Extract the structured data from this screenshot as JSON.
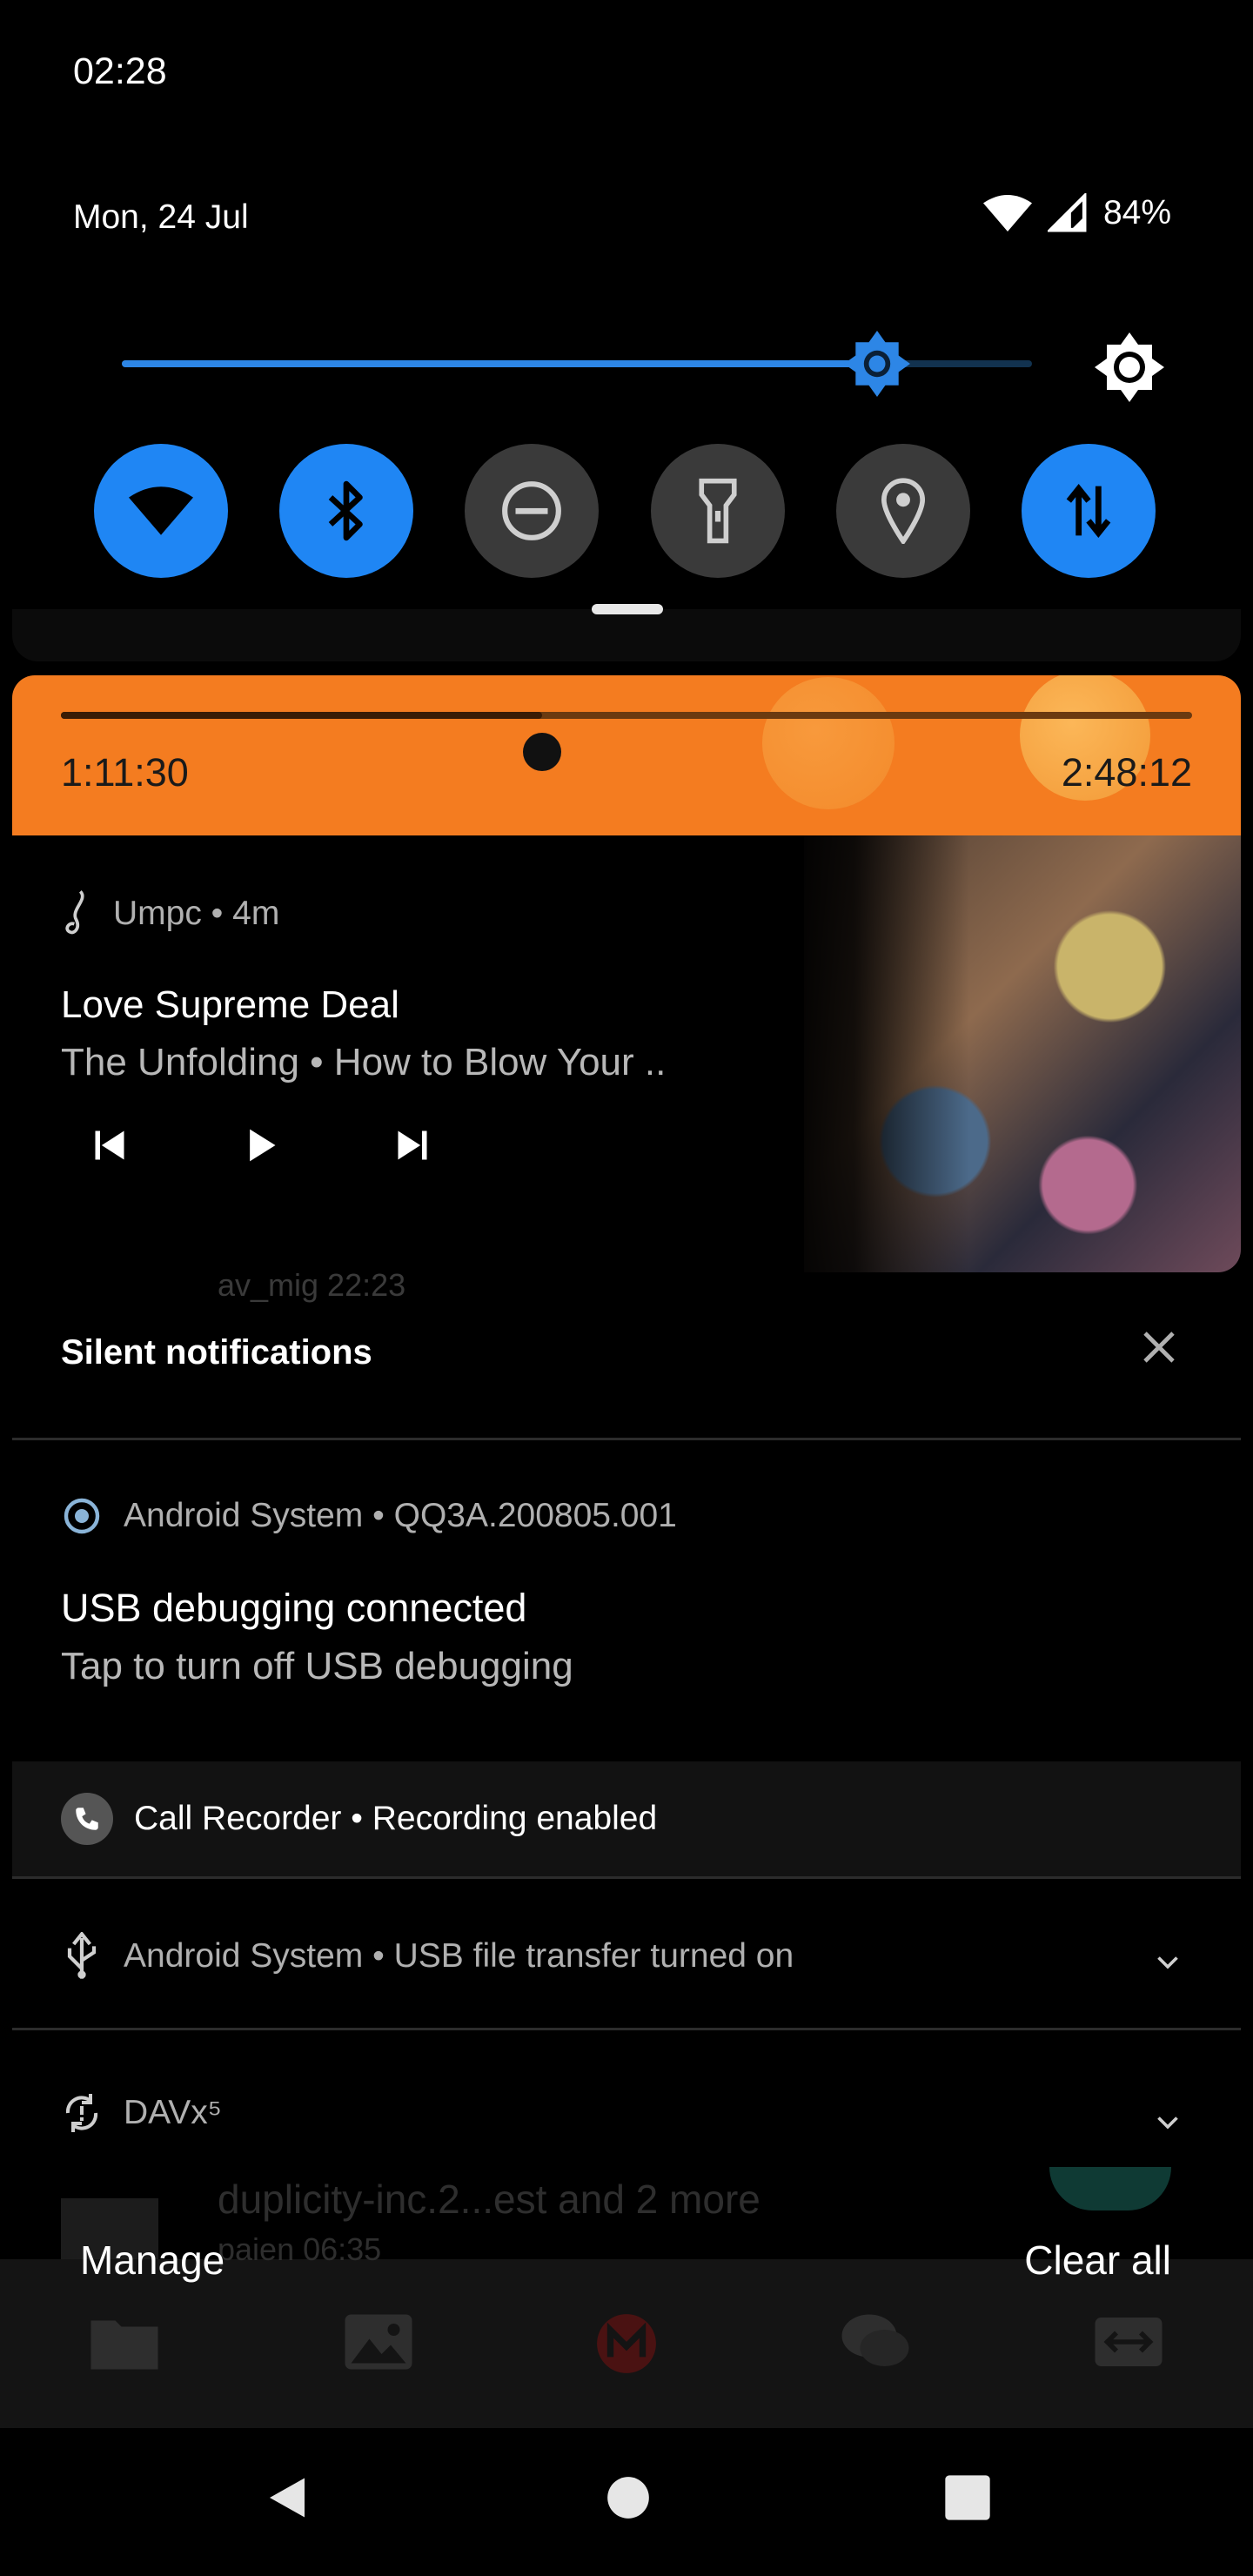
{
  "status": {
    "time": "02:28",
    "date": "Mon, 24 Jul",
    "battery": "84%"
  },
  "brightness": {
    "level": 0.83
  },
  "quick_tiles": [
    {
      "name": "wifi",
      "icon": "wifi-icon",
      "on": true
    },
    {
      "name": "bluetooth",
      "icon": "bluetooth-icon",
      "on": true
    },
    {
      "name": "do-not-disturb",
      "icon": "dnd-icon",
      "on": false
    },
    {
      "name": "flashlight",
      "icon": "flashlight-icon",
      "on": false
    },
    {
      "name": "location",
      "icon": "location-icon",
      "on": false
    },
    {
      "name": "mobile-data",
      "icon": "data-arrows-icon",
      "on": true
    }
  ],
  "media": {
    "app": "Umpc",
    "age": "4m",
    "app_line": "Umpc • 4m",
    "title": "Love Supreme Deal",
    "subtitle": "The Unfolding • How to Blow Your ..",
    "elapsed": "1:11:30",
    "total": "2:48:12",
    "progress": 0.425,
    "accent": "#f47c20"
  },
  "background_rows": {
    "row1": "av_mig   22:23",
    "row2": "duplicity-inc.2...est and 2 more",
    "row3": "paien   06:35"
  },
  "silent": {
    "header": "Silent notifications",
    "usb": {
      "app_line": "Android System • QQ3A.200805.001",
      "title": "USB debugging connected",
      "subtitle": "Tap to turn off USB debugging"
    },
    "call_recorder": "Call Recorder • Recording enabled",
    "usb_transfer": "Android System • USB file transfer turned on",
    "davx": "DAVx⁵"
  },
  "footer": {
    "manage": "Manage",
    "clear_all": "Clear all"
  }
}
